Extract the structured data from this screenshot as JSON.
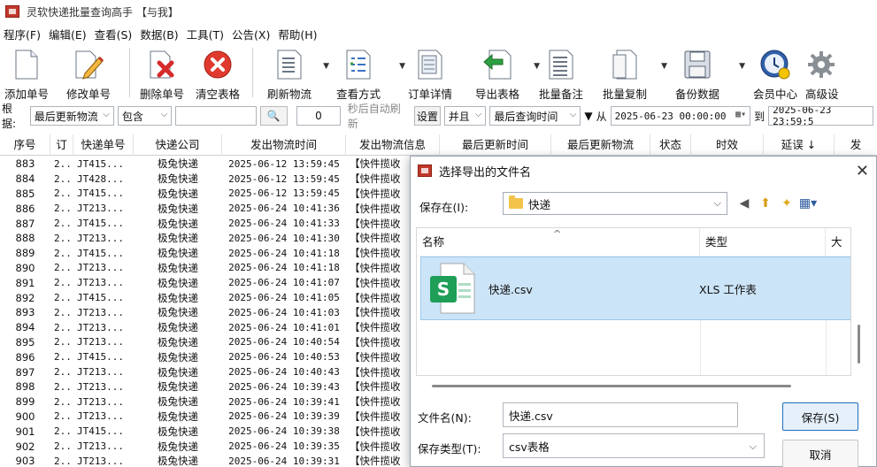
{
  "window": {
    "title": "灵软快递批量查询高手 【与我】"
  },
  "menu": [
    "程序(F)",
    "编辑(E)",
    "查看(S)",
    "数据(B)",
    "工具(T)",
    "公告(X)",
    "帮助(H)"
  ],
  "toolbar": {
    "add": "添加单号",
    "edit": "修改单号",
    "delete": "删除单号",
    "clear": "清空表格",
    "refresh": "刷新物流",
    "view": "查看方式",
    "detail": "订单详情",
    "export": "导出表格",
    "note": "批量备注",
    "copy": "批量复制",
    "backup": "备份数据",
    "member": "会员中心",
    "advanced": "高级设"
  },
  "filter": {
    "based_on_label": "根据:",
    "field": "最后更新物流",
    "op": "包含",
    "keyword": "",
    "auto_refresh_seconds": "0",
    "auto_refresh_label": "秒后自动刷新",
    "settings": "设置",
    "and": "并且",
    "time_field": "最后查询时间",
    "from_label": "从",
    "from": "2025-06-23 00:00:00",
    "to_label": "到",
    "to": "2025-06-23 23:59:5"
  },
  "table": {
    "headers": [
      "序号",
      "订",
      "快递单号",
      "快递公司",
      "发出物流时间",
      "发出物流信息",
      "最后更新时间",
      "最后更新物流",
      "状态",
      "时效",
      "延误 ↓",
      "发"
    ],
    "rows": [
      {
        "no": "883",
        "o": "2...",
        "num": "JT415...",
        "co": "极兔快递",
        "time": "2025-06-12 13:59:45",
        "info": "【快件揽收"
      },
      {
        "no": "884",
        "o": "2...",
        "num": "JT428...",
        "co": "极兔快递",
        "time": "2025-06-12 13:59:45",
        "info": "【快件揽收"
      },
      {
        "no": "885",
        "o": "2...",
        "num": "JT415...",
        "co": "极兔快递",
        "time": "2025-06-12 13:59:45",
        "info": "【快件揽收"
      },
      {
        "no": "886",
        "o": "2...",
        "num": "JT213...",
        "co": "极兔快递",
        "time": "2025-06-24 10:41:36",
        "info": "【快件揽收"
      },
      {
        "no": "887",
        "o": "2...",
        "num": "JT415...",
        "co": "极兔快递",
        "time": "2025-06-24 10:41:33",
        "info": "【快件揽收"
      },
      {
        "no": "888",
        "o": "2...",
        "num": "JT213...",
        "co": "极兔快递",
        "time": "2025-06-24 10:41:30",
        "info": "【快件揽收"
      },
      {
        "no": "889",
        "o": "2...",
        "num": "JT415...",
        "co": "极兔快递",
        "time": "2025-06-24 10:41:18",
        "info": "【快件揽收"
      },
      {
        "no": "890",
        "o": "2...",
        "num": "JT213...",
        "co": "极兔快递",
        "time": "2025-06-24 10:41:18",
        "info": "【快件揽收"
      },
      {
        "no": "891",
        "o": "2...",
        "num": "JT213...",
        "co": "极兔快递",
        "time": "2025-06-24 10:41:07",
        "info": "【快件揽收"
      },
      {
        "no": "892",
        "o": "2...",
        "num": "JT415...",
        "co": "极兔快递",
        "time": "2025-06-24 10:41:05",
        "info": "【快件揽收"
      },
      {
        "no": "893",
        "o": "2...",
        "num": "JT213...",
        "co": "极兔快递",
        "time": "2025-06-24 10:41:03",
        "info": "【快件揽收"
      },
      {
        "no": "894",
        "o": "2...",
        "num": "JT213...",
        "co": "极兔快递",
        "time": "2025-06-24 10:41:01",
        "info": "【快件揽收"
      },
      {
        "no": "895",
        "o": "2...",
        "num": "JT213...",
        "co": "极兔快递",
        "time": "2025-06-24 10:40:54",
        "info": "【快件揽收"
      },
      {
        "no": "896",
        "o": "2...",
        "num": "JT415...",
        "co": "极兔快递",
        "time": "2025-06-24 10:40:53",
        "info": "【快件揽收"
      },
      {
        "no": "897",
        "o": "2...",
        "num": "JT213...",
        "co": "极兔快递",
        "time": "2025-06-24 10:40:43",
        "info": "【快件揽收"
      },
      {
        "no": "898",
        "o": "2...",
        "num": "JT213...",
        "co": "极兔快递",
        "time": "2025-06-24 10:39:43",
        "info": "【快件揽收"
      },
      {
        "no": "899",
        "o": "2...",
        "num": "JT213...",
        "co": "极兔快递",
        "time": "2025-06-24 10:39:41",
        "info": "【快件揽收"
      },
      {
        "no": "900",
        "o": "2...",
        "num": "JT213...",
        "co": "极兔快递",
        "time": "2025-06-24 10:39:39",
        "info": "【快件揽收"
      },
      {
        "no": "901",
        "o": "2...",
        "num": "JT415...",
        "co": "极兔快递",
        "time": "2025-06-24 10:39:38",
        "info": "【快件揽收"
      },
      {
        "no": "902",
        "o": "2...",
        "num": "JT213...",
        "co": "极兔快递",
        "time": "2025-06-24 10:39:35",
        "info": "【快件揽收"
      },
      {
        "no": "903",
        "o": "2...",
        "num": "JT213...",
        "co": "极兔快递",
        "time": "2025-06-24 10:39:31",
        "info": "【快件揽收"
      }
    ]
  },
  "dialog": {
    "title": "选择导出的文件名",
    "save_in_label": "保存在(I):",
    "save_in_value": "快递",
    "col_name": "名称",
    "col_type": "类型",
    "col_size": "大小",
    "file": {
      "name": "快递.csv",
      "type": "XLS 工作表"
    },
    "filename_label": "文件名(N):",
    "filename_value": "快递.csv",
    "filetype_label": "保存类型(T):",
    "filetype_value": "csv表格",
    "save_btn": "保存(S)",
    "cancel_btn": "取消"
  },
  "colors": {
    "selection": "#cce4f7",
    "accent": "#1f6fbf"
  }
}
